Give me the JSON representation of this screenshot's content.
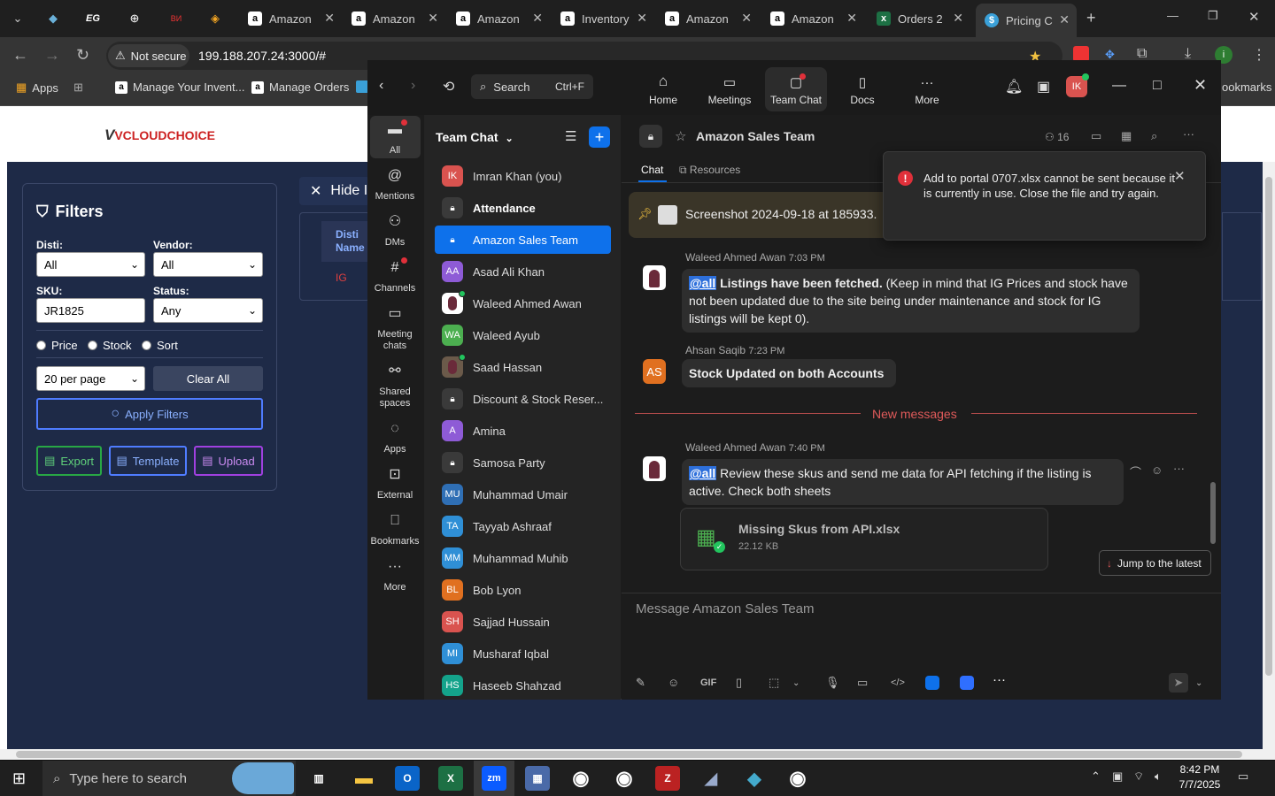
{
  "browser": {
    "tabs": [
      {
        "label": "Amazon",
        "fav": "a"
      },
      {
        "label": "Amazon",
        "fav": "a"
      },
      {
        "label": "Amazon",
        "fav": "a"
      },
      {
        "label": "Inventory",
        "fav": "a"
      },
      {
        "label": "Amazon",
        "fav": "a"
      },
      {
        "label": "Amazon",
        "fav": "a"
      },
      {
        "label": "Orders 2",
        "fav": "x"
      },
      {
        "label": "Pricing C",
        "fav": "$"
      }
    ],
    "pinned_tabs": [
      "EG",
      "ВИ"
    ],
    "security_label": "Not secure",
    "url": "199.188.207.24:3000/#",
    "bookmarks": [
      {
        "label": "Apps"
      },
      {
        "label": "Manage Your Invent..."
      },
      {
        "label": "Manage Orders"
      },
      {
        "label": "ookmarks"
      }
    ]
  },
  "page": {
    "logo": "VCLOUDCHOICE",
    "filters_title": "Filters",
    "disti_label": "Disti:",
    "disti_value": "All",
    "vendor_label": "Vendor:",
    "vendor_value": "All",
    "sku_label": "SKU:",
    "sku_value": "JR1825",
    "status_label": "Status:",
    "status_value": "Any",
    "radios": [
      "Price",
      "Stock",
      "Sort"
    ],
    "per_page": "20 per page",
    "clear_all": "Clear All",
    "apply": "Apply Filters",
    "export": "Export",
    "template": "Template",
    "upload": "Upload",
    "hide": "Hide I",
    "table_header": "Disti Name",
    "table_cell": "IG"
  },
  "zoom": {
    "search_label": "Search",
    "search_shortcut": "Ctrl+F",
    "top_tabs": [
      "Home",
      "Meetings",
      "Team Chat",
      "Docs",
      "More"
    ],
    "avatar_initials": "IK",
    "rail": [
      "All",
      "Mentions",
      "DMs",
      "Channels",
      "Meeting chats",
      "Shared spaces",
      "Apps",
      "External",
      "Bookmarks",
      "More"
    ],
    "list_title": "Team Chat",
    "contacts": [
      {
        "name": "Imran Khan (you)",
        "initials": "IK",
        "color": "#d9534f",
        "type": "user",
        "online": true
      },
      {
        "name": "Attendance",
        "initials": "",
        "color": "#3a3a3a",
        "type": "channel",
        "bold": true
      },
      {
        "name": "Amazon Sales Team",
        "initials": "",
        "color": "#3a3a3a",
        "type": "channel",
        "selected": true
      },
      {
        "name": "Asad Ali Khan",
        "initials": "AA",
        "color": "#8e5bd6",
        "type": "user",
        "online": true
      },
      {
        "name": "Waleed Ahmed Awan",
        "initials": "",
        "color": "#ffffff",
        "type": "photo",
        "online": true
      },
      {
        "name": "Waleed Ayub",
        "initials": "WA",
        "color": "#4caf50",
        "type": "user",
        "online": true
      },
      {
        "name": "Saad Hassan",
        "initials": "",
        "color": "#6b5a4a",
        "type": "photo",
        "online": true
      },
      {
        "name": "Discount & Stock Reser...",
        "initials": "",
        "color": "#3a3a3a",
        "type": "channel"
      },
      {
        "name": "Amina",
        "initials": "A",
        "color": "#8e5bd6",
        "type": "user",
        "online": true
      },
      {
        "name": "Samosa Party",
        "initials": "",
        "color": "#3a3a3a",
        "type": "channel"
      },
      {
        "name": "Muhammad Umair",
        "initials": "MU",
        "color": "#2f6fb5",
        "type": "user",
        "online": true
      },
      {
        "name": "Tayyab Ashraaf",
        "initials": "TA",
        "color": "#2f8fd6",
        "type": "user",
        "online": true
      },
      {
        "name": "Muhammad Muhib",
        "initials": "MM",
        "color": "#2f8fd6",
        "type": "user",
        "online": true
      },
      {
        "name": "Bob Lyon",
        "initials": "BL",
        "color": "#e07020",
        "type": "user",
        "online": true
      },
      {
        "name": "Sajjad Hussain",
        "initials": "SH",
        "color": "#d9534f",
        "type": "user",
        "online": true
      },
      {
        "name": "Musharaf Iqbal",
        "initials": "MI",
        "color": "#2f8fd6",
        "type": "user",
        "online": true
      },
      {
        "name": "Haseeb Shahzad",
        "initials": "HS",
        "color": "#14a38b",
        "type": "user",
        "online": true
      }
    ],
    "channel_name": "Amazon Sales Team",
    "member_count": "16",
    "chat_tabs": [
      "Chat",
      "Resources"
    ],
    "pinned_text": "Screenshot 2024-09-18 at 185933.",
    "messages": [
      {
        "sender": "Waleed Ahmed Awan",
        "time": "7:03 PM",
        "mention": "@all",
        "bold": "Listings have been fetched.",
        "text": " (Keep in mind that IG Prices and stock have not been updated due to the site being under maintenance and stock for IG listings will be kept 0)."
      },
      {
        "sender": "Ahsan Saqib",
        "time": "7:23 PM",
        "initials": "AS",
        "text": "Stock Updated on both Accounts"
      },
      {
        "sender": "Waleed Ahmed Awan",
        "time": "7:40 PM",
        "mention": "@all",
        "text": " Review these skus and send me data for API fetching if the listing is active. Check both sheets"
      }
    ],
    "new_messages": "New messages",
    "file_name": "Missing Skus from API.xlsx",
    "file_size": "22.12 KB",
    "jump_latest": "Jump to the latest",
    "composer_placeholder": "Message Amazon Sales Team",
    "toolbar_gif": "GIF",
    "toast": "Add to portal 0707.xlsx cannot be sent because it is currently in use. Close the file and try again."
  },
  "taskbar": {
    "search_placeholder": "Type here to search",
    "time": "8:42 PM",
    "date": "7/7/2025"
  },
  "colors": {
    "accent": "#0e71eb",
    "navy": "#1e2a47",
    "danger": "#e0303a",
    "new_messages": "#e05a5a"
  }
}
